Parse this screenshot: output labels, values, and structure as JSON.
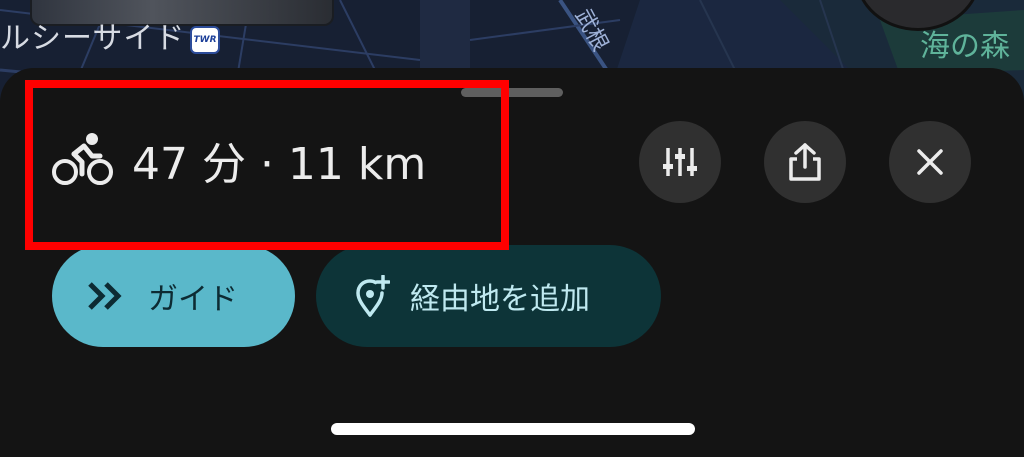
{
  "map": {
    "area_label": "ルシーサイド",
    "road_label": "武根",
    "park_label": "海の森",
    "logo_text": "TWR",
    "colors": {
      "background": "#172033",
      "roads": "#2c3d63",
      "park": "#1c3b3a"
    }
  },
  "route_summary": {
    "mode_icon": "bicycle-icon",
    "text": "47 分 · 11 km"
  },
  "actions": {
    "filter_icon": "tune-icon",
    "share_icon": "share-icon",
    "close_icon": "close-icon"
  },
  "chips": {
    "guide": {
      "icon": "double-chevron-right-icon",
      "label": "ガイド",
      "color": "#5ab8ca"
    },
    "add_stop": {
      "icon": "add-location-icon",
      "label": "経由地を追加",
      "color": "#0d3438"
    }
  },
  "highlight": {
    "color": "#ff0000"
  }
}
